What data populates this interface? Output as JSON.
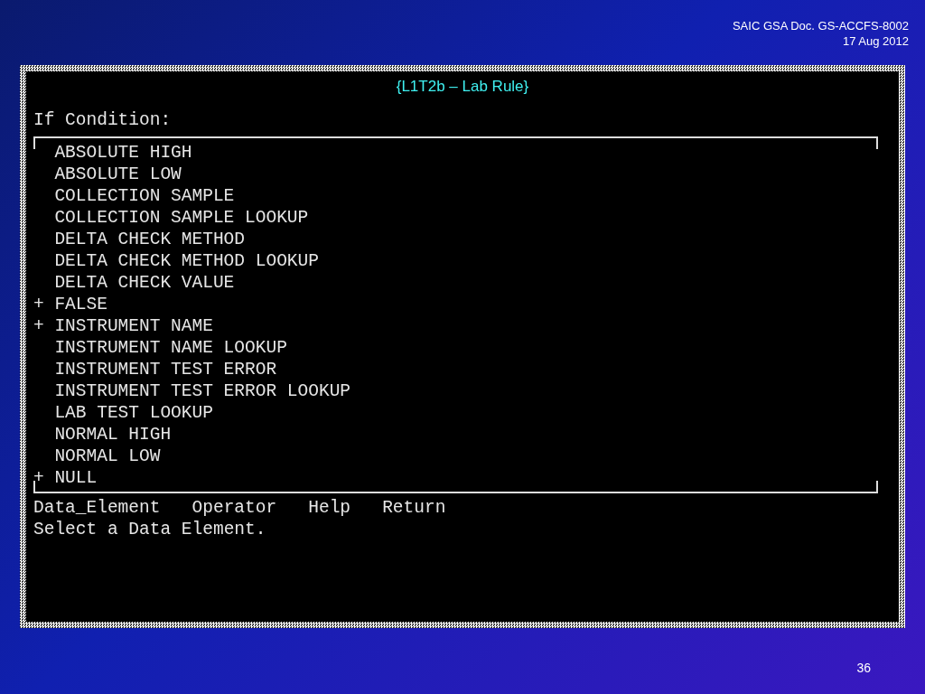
{
  "header": {
    "doc": "SAIC GSA Doc. GS-ACCFS-8002",
    "date": "17 Aug 2012"
  },
  "screen": {
    "title": "{L1T2b – Lab Rule}",
    "prompt": "If Condition:",
    "marker": "+",
    "items": [
      {
        "label": "ABSOLUTE HIGH",
        "marked": false
      },
      {
        "label": "ABSOLUTE LOW",
        "marked": false
      },
      {
        "label": "COLLECTION SAMPLE",
        "marked": false
      },
      {
        "label": "COLLECTION SAMPLE LOOKUP",
        "marked": false
      },
      {
        "label": "DELTA CHECK METHOD",
        "marked": false
      },
      {
        "label": "DELTA CHECK METHOD LOOKUP",
        "marked": false
      },
      {
        "label": "DELTA CHECK VALUE",
        "marked": false
      },
      {
        "label": "FALSE",
        "marked": true
      },
      {
        "label": "INSTRUMENT NAME",
        "marked": true
      },
      {
        "label": "INSTRUMENT NAME LOOKUP",
        "marked": false
      },
      {
        "label": "INSTRUMENT TEST ERROR",
        "marked": false
      },
      {
        "label": "INSTRUMENT TEST ERROR LOOKUP",
        "marked": false
      },
      {
        "label": "LAB TEST LOOKUP",
        "marked": false
      },
      {
        "label": "NORMAL HIGH",
        "marked": false
      },
      {
        "label": "NORMAL LOW",
        "marked": false
      },
      {
        "label": "NULL",
        "marked": true
      }
    ],
    "menu": [
      "Data_Element",
      "Operator",
      "Help",
      "Return"
    ],
    "message": "Select a Data Element."
  },
  "page_number": "36"
}
